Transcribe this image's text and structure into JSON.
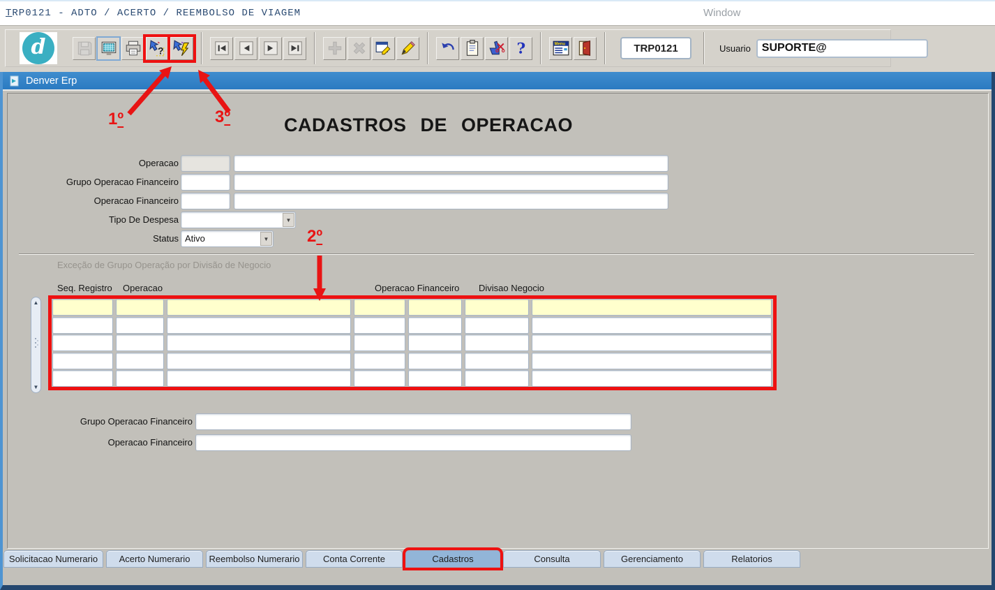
{
  "menu_bar": {
    "title": "TRP0121 - ADTO / ACERTO / REEMBOLSO DE VIAGEM",
    "window_menu_label": "Window"
  },
  "toolbar": {
    "module_code": "TRP0121",
    "user_label": "Usuario",
    "user_value": "SUPORTE@",
    "groups": [
      {
        "buttons": [
          {
            "name": "save",
            "icon": "floppy-icon",
            "disabled": true
          },
          {
            "name": "display",
            "icon": "monitor-icon",
            "focused": true
          },
          {
            "name": "print",
            "icon": "printer-icon"
          },
          {
            "name": "enter-query",
            "icon": "query-question-icon",
            "highlighted": true
          },
          {
            "name": "execute-query",
            "icon": "query-lightning-icon",
            "highlighted": true
          }
        ]
      },
      {
        "buttons": [
          {
            "name": "first-record",
            "icon": "first-record-icon"
          },
          {
            "name": "previous-record",
            "icon": "previous-record-icon"
          },
          {
            "name": "next-record",
            "icon": "next-record-icon"
          },
          {
            "name": "last-record",
            "icon": "last-record-icon"
          }
        ]
      },
      {
        "buttons": [
          {
            "name": "insert-record",
            "icon": "plus-icon",
            "disabled": true
          },
          {
            "name": "delete-record",
            "icon": "cross-icon",
            "disabled": true
          },
          {
            "name": "lock-record",
            "icon": "window-edit-icon"
          },
          {
            "name": "edit-field",
            "icon": "pencil-icon"
          }
        ]
      },
      {
        "buttons": [
          {
            "name": "undo",
            "icon": "undo-arrow-icon"
          },
          {
            "name": "clipboard",
            "icon": "clipboard-icon"
          },
          {
            "name": "cut",
            "icon": "hand-scissors-icon"
          },
          {
            "name": "help",
            "icon": "question-mark-icon"
          }
        ]
      },
      {
        "buttons": [
          {
            "name": "menu",
            "icon": "menu-window-icon"
          },
          {
            "name": "exit",
            "icon": "exit-door-icon"
          }
        ]
      }
    ]
  },
  "window": {
    "title": "Denver Erp"
  },
  "form": {
    "title": "CADASTROS DE OPERACAO",
    "fields": {
      "operacao_label": "Operacao",
      "grupo_operacao_financeiro_label": "Grupo Operacao Financeiro",
      "operacao_financeiro_label": "Operacao Financeiro",
      "tipo_de_despesa_label": "Tipo De Despesa",
      "tipo_de_despesa_value": "",
      "status_label": "Status",
      "status_value": "Ativo"
    },
    "section": {
      "title": "Exceção de Grupo Operação por Divisão de Negocio",
      "column_headers": [
        "Seq. Registro",
        "Operacao",
        "Operacao Financeiro",
        "Divisao Negocio"
      ],
      "visible_rows": 5,
      "columns_per_row": 7,
      "active_row_color": "#ffffcd"
    },
    "lower_fields": {
      "grupo_operacao_financeiro_label": "Grupo Operacao Financeiro",
      "operacao_financeiro_label": "Operacao Financeiro"
    }
  },
  "annotations": {
    "step_1": "1º",
    "step_2": "2º",
    "step_3": "3º",
    "color": "#e81414"
  },
  "tabs": {
    "items": [
      "Solicitacao Numerario",
      "Acerto Numerario",
      "Reembolso Numerario",
      "Conta Corrente",
      "Cadastros",
      "Consulta",
      "Gerenciamento",
      "Relatorios"
    ],
    "selected": "Cadastros"
  },
  "colors": {
    "titlebar_blue": "#2f80c6",
    "annotation_red": "#ee1111",
    "selected_tab_blue": "#92b5d8",
    "content_gray": "#c2c0ba"
  }
}
